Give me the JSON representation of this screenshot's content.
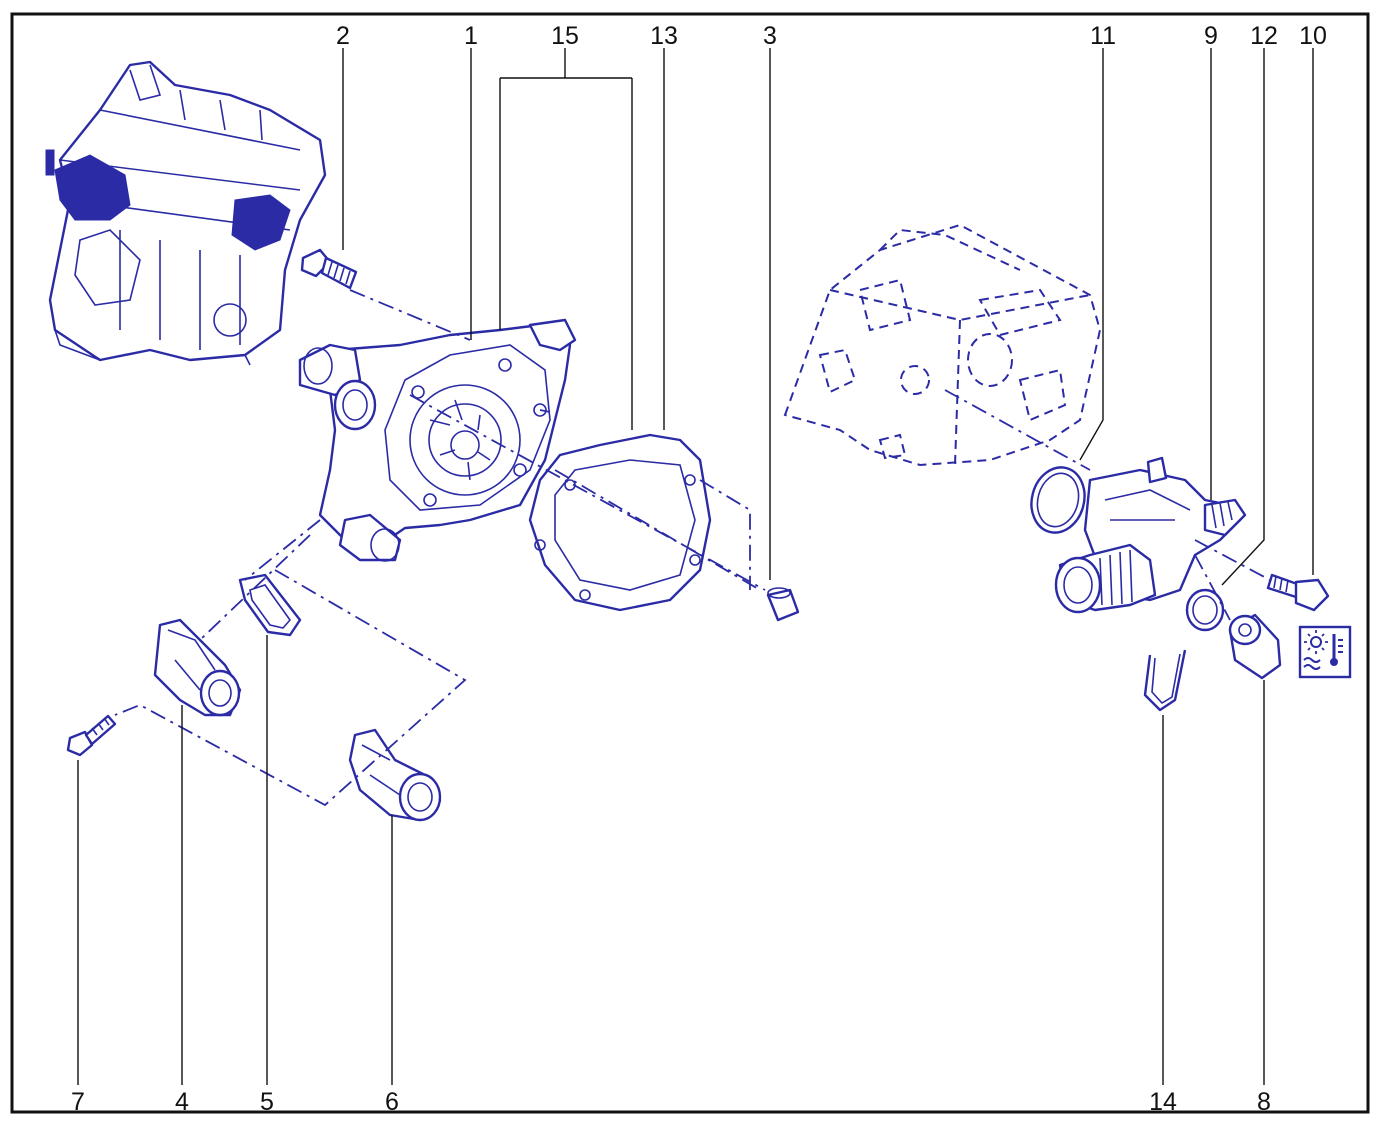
{
  "colors": {
    "line": "#2b2ba6",
    "frame": "#111111",
    "text": "#111111",
    "background": "#ffffff"
  },
  "callouts": [
    "1",
    "2",
    "3",
    "4",
    "5",
    "6",
    "7",
    "8",
    "9",
    "10",
    "11",
    "12",
    "13",
    "14",
    "15"
  ],
  "symbol": {
    "icon": "coolant-temperature-icon"
  }
}
